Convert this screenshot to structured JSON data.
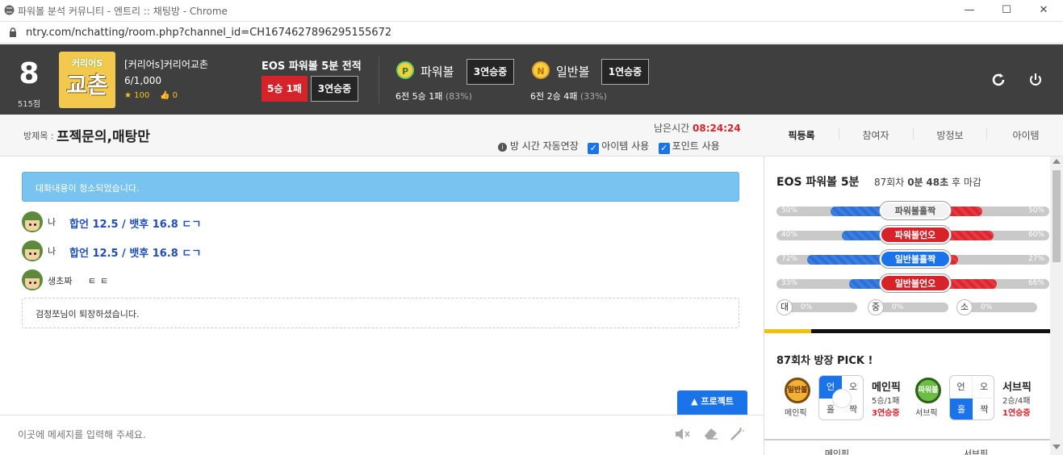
{
  "window": {
    "title": "파워볼 분석 커뮤니티 - 엔트리 :: 채팅방 - Chrome",
    "url": "ntry.com/nchatting/room.php?channel_id=CH1674627896295155672"
  },
  "header": {
    "rank": "8",
    "points": "515점",
    "logo_text_top": "커리어S",
    "logo_text": "교촌",
    "room_name": "[커리어s]커리어교촌",
    "members": "6/1,000",
    "stars": "100",
    "likes": "0",
    "record_title": "EOS 파워볼 5분 전적",
    "record_wl": "5승 1패",
    "record_streak": "3연승중",
    "powerball_label": "파워볼",
    "powerball_icon": "P",
    "powerball_streak": "3연승중",
    "powerball_stat": "6전 5승 1패",
    "powerball_rate": "(83%)",
    "normal_label": "일반볼",
    "normal_icon": "N",
    "normal_streak": "1연승중",
    "normal_stat": "6전 2승 4패",
    "normal_rate": "(33%)",
    "refresh_icon": "refresh-icon",
    "power_icon": "power-icon"
  },
  "subheader": {
    "title_label": "방제목 :",
    "title": "프젝문의,매탕만",
    "remaining_label": "남은시간",
    "remaining": "08:24:24",
    "auto_extend": "방 시간 자동연장",
    "item_use": "아이템 사용",
    "point_use": "포인트 사용",
    "tabs": [
      "픽등록",
      "참여자",
      "방정보",
      "아이템"
    ]
  },
  "chat": {
    "notice": "대화내용이 청소되었습니다.",
    "messages": [
      {
        "user": "나",
        "text": "합언 12.5 / 뱃후 16.8 ㄷㄱ"
      },
      {
        "user": "나",
        "text": "합언 12.5 / 뱃후 16.8 ㄷㄱ"
      },
      {
        "user": "생초짜",
        "text": "ㅌㅌ"
      }
    ],
    "leave_user": "검정쪼",
    "leave_text": "님이 퇴장하셨습니다.",
    "project_button": "▲ 프로젝트",
    "input_placeholder": "이곳에 메세지를 입력해 주세요."
  },
  "panel": {
    "game_title": "EOS 파워볼 5분",
    "round": "87회차",
    "time_min": "0분",
    "time_sec": "48초",
    "deadline": "후 마감",
    "bars": [
      {
        "left": "50%",
        "label": "파워볼홀짝",
        "right": "50%",
        "l": 50,
        "r": 50,
        "style": "white"
      },
      {
        "left": "40%",
        "label": "파워볼언오",
        "right": "60%",
        "l": 40,
        "r": 60,
        "style": "red"
      },
      {
        "left": "72%",
        "label": "일반볼홀짝",
        "right": "27%",
        "l": 72,
        "r": 27,
        "style": "blue"
      },
      {
        "left": "33%",
        "label": "일반볼언오",
        "right": "66%",
        "l": 33,
        "r": 66,
        "style": "red"
      }
    ],
    "sizes": [
      {
        "label": "대",
        "pct": "0%"
      },
      {
        "label": "중",
        "pct": "0%"
      },
      {
        "label": "소",
        "pct": "0%"
      }
    ],
    "pick_title": "87회차 방장 PICK !",
    "main_pick": {
      "icon": "일반볼",
      "label": "메인픽",
      "cells": [
        "언",
        "오",
        "홀",
        "짝"
      ],
      "title": "메인픽",
      "record": "5승/1패",
      "streak": "3연승중"
    },
    "sub_pick": {
      "icon": "파워볼",
      "label": "서브픽",
      "cells": [
        "언",
        "오",
        "홀",
        "짝"
      ],
      "title": "서브픽",
      "record": "2승/4패",
      "streak": "1연승중"
    },
    "footer": [
      "메인픽",
      "서브픽"
    ]
  }
}
